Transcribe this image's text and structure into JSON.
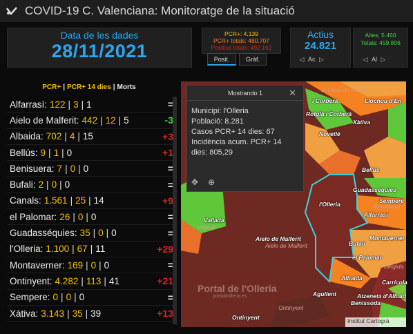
{
  "app": {
    "title": "COVID-19 C. Valenciana: Monitoratge de la situació"
  },
  "date_panel": {
    "label": "Data de les dades",
    "date": "28/11/2021"
  },
  "pcr_panel": {
    "pcr": "PCR+: 4.139",
    "pcr_total": "PCR+ totals: 480.707",
    "pos_total": "Positius totals: 492.162"
  },
  "tabs": {
    "posit": "Posit.",
    "graf": "Gràf."
  },
  "actius": {
    "label": "Actius",
    "value": "24.821",
    "pager": "Ac"
  },
  "altes": {
    "altes": "Altes: 5.460",
    "totals": "Totals: 459.806",
    "pager": "Al"
  },
  "list_header": {
    "pcr": "PCR+",
    "pcr14": "PCR+ 14 dies",
    "morts": "Morts",
    "sep": "|"
  },
  "rows": [
    {
      "town": "Alfarrasí:",
      "pcr": "122",
      "pcr14": "3",
      "morts": "1",
      "change": "="
    },
    {
      "town": "Aielo de Malferit:",
      "pcr": "442",
      "pcr14": "12",
      "morts": "5",
      "change": "-3"
    },
    {
      "town": "Albaida:",
      "pcr": "702",
      "pcr14": "4",
      "morts": "15",
      "change": "+3"
    },
    {
      "town": "Bellús:",
      "pcr": "9",
      "pcr14": "1",
      "morts": "0",
      "change": "+1"
    },
    {
      "town": "Benisuera:",
      "pcr": "7",
      "pcr14": "0",
      "morts": "0",
      "change": "="
    },
    {
      "town": "Bufali:",
      "pcr": "2",
      "pcr14": "0",
      "morts": "0",
      "change": "="
    },
    {
      "town": "Canals:",
      "pcr": "1.561",
      "pcr14": "25",
      "morts": "14",
      "change": "+9"
    },
    {
      "town": "el Palomar:",
      "pcr": "26",
      "pcr14": "0",
      "morts": "0",
      "change": "="
    },
    {
      "town": "Guadasséquies:",
      "pcr": "35",
      "pcr14": "0",
      "morts": "0",
      "change": "="
    },
    {
      "town": "l'Olleria:",
      "pcr": "1.100",
      "pcr14": "67",
      "morts": "11",
      "change": "+29"
    },
    {
      "town": "Montaverner:",
      "pcr": "169",
      "pcr14": "0",
      "morts": "0",
      "change": "="
    },
    {
      "town": "Ontinyent:",
      "pcr": "4.282",
      "pcr14": "113",
      "morts": "41",
      "change": "+21"
    },
    {
      "town": "Sempere:",
      "pcr": "0",
      "pcr14": "0",
      "morts": "0",
      "change": "="
    },
    {
      "town": "Xàtiva:",
      "pcr": "3.143",
      "pcr14": "35",
      "morts": "39",
      "change": "+13"
    }
  ],
  "popup": {
    "title": "Mostrando 1",
    "municipi": "Municipi: l'Olleria",
    "poblacio": "Població: 8.281",
    "casos": "Casos PCR+ 14 dies: 67",
    "incidencia1": "Incidència acum. PCR+ 14",
    "incidencia2": "dies: 805,29"
  },
  "map_labels": {
    "llosa": "la Llosa de Ranes",
    "corbera": "i Corberà",
    "llocnou": "Llocnou d'En",
    "rotglai": "Rotglà i Corberà",
    "novetle": "Novetlè",
    "xativa": "Xàtiva",
    "bellus": "Bellús",
    "guadass": "Guadasséquies",
    "sempere": "Sempere",
    "benisuera": "Benisuera",
    "olleria": "l'Olleria",
    "alfarrasi": "Alfarrasí",
    "vallada": "Vallada",
    "vallada2": "Vallada",
    "aielo": "Aielo de Malferit",
    "aielo2": "Aielo de Malferit",
    "montaverner": "Montaverner",
    "bufali": "Bufali",
    "palomar": "el Palomar",
    "belgida": "Bèlgida",
    "albaida": "Albaida",
    "carricola": "Carrícola",
    "agullent": "Agullent",
    "benissoda": "Benissoda",
    "atzeneta": "Atzeneta d'Albaid",
    "ontinyent": "Ontinyent",
    "ontinyent2": "Ontinyent"
  },
  "watermark": {
    "name": "Portal de l'Olleria",
    "url": "portaldolleria.es"
  },
  "attribution": "Institut Cartogrà",
  "colors": {
    "accent": "#2aa7ee",
    "pcr": "#f2c200",
    "pcr14": "#f58220",
    "up": "#e02020",
    "down": "#3fd43f"
  }
}
